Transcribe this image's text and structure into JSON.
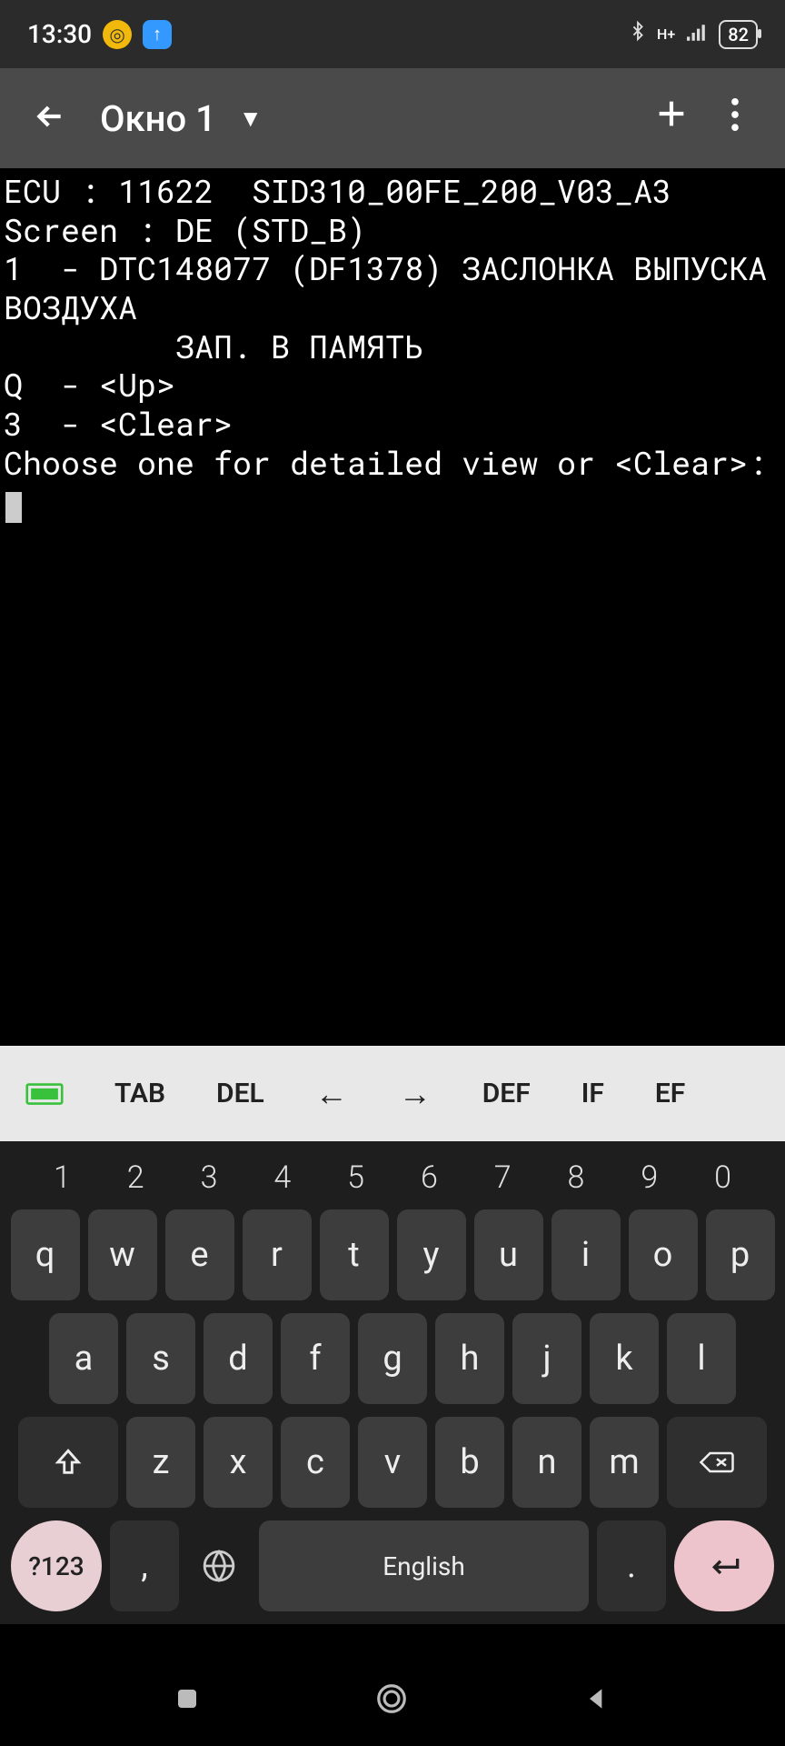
{
  "status": {
    "time": "13:30",
    "battery": "82",
    "net_label": "H+"
  },
  "appbar": {
    "title": "Окно 1"
  },
  "terminal": {
    "lines": [
      "ECU : 11622  SID310_00FE_200_V03_A3",
      "Screen : DE (STD_B)",
      "1  - DTC148077 (DF1378) ЗАСЛОНКА ВЫПУСКА ВОЗДУХА",
      "         ЗАП. В ПАМЯТЬ",
      "Q  - <Up>",
      "3  - <Clear>",
      "Choose one for detailed view or <Clear>:"
    ]
  },
  "extra": {
    "k1": "TAB",
    "k2": "DEL",
    "k3": "←",
    "k4": "→",
    "k5": "DEF",
    "k6": "IF",
    "k7": "EF"
  },
  "keyboard": {
    "nums": [
      "1",
      "2",
      "3",
      "4",
      "5",
      "6",
      "7",
      "8",
      "9",
      "0"
    ],
    "row1": [
      "q",
      "w",
      "e",
      "r",
      "t",
      "y",
      "u",
      "i",
      "o",
      "p"
    ],
    "row2": [
      "a",
      "s",
      "d",
      "f",
      "g",
      "h",
      "j",
      "k",
      "l"
    ],
    "row3": [
      "z",
      "x",
      "c",
      "v",
      "b",
      "n",
      "m"
    ],
    "sym": "?123",
    "space": "English",
    "comma": ",",
    "period": "."
  }
}
